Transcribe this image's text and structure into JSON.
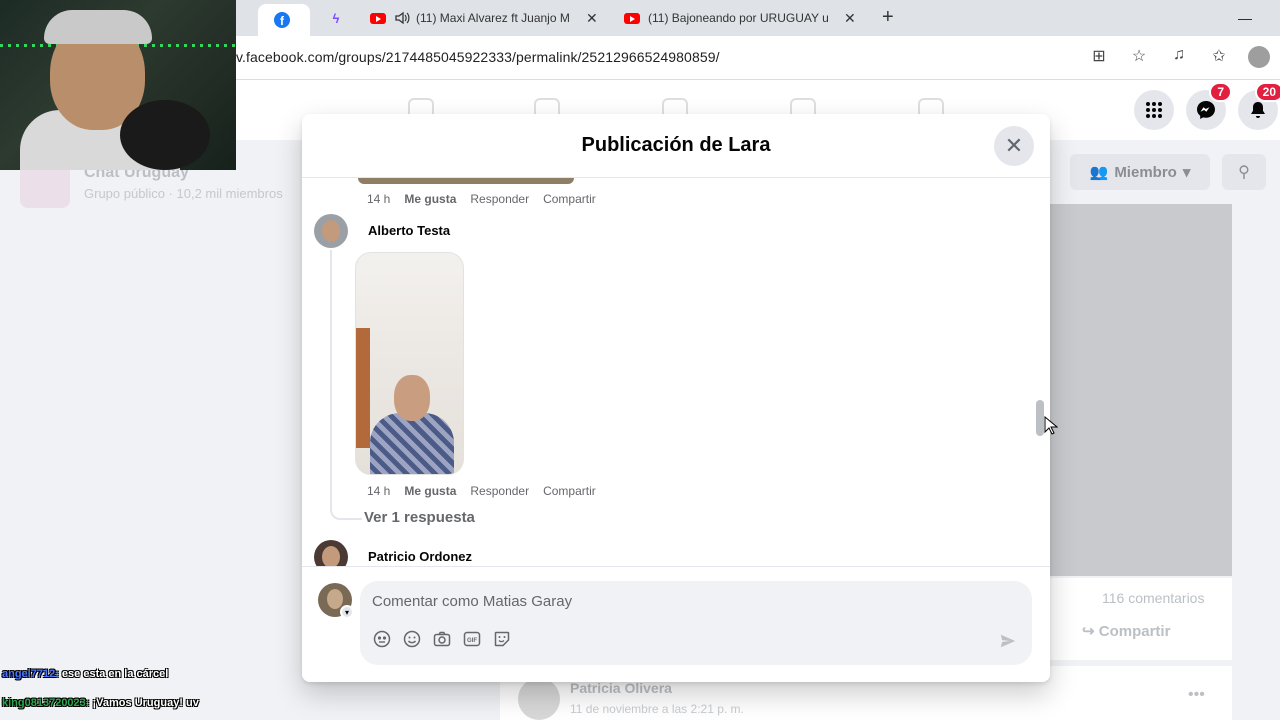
{
  "browser": {
    "tabs": [
      {
        "title": "",
        "icon": "facebook-icon"
      },
      {
        "title": "",
        "icon": "messenger-icon"
      },
      {
        "title": "(11) Maxi Alvarez ft Juanjo M",
        "icon": "youtube-icon"
      },
      {
        "title": "(11) Bajoneando por URUGUAY u",
        "icon": "youtube-icon"
      }
    ],
    "url": "v.facebook.com/groups/2174485045922333/permalink/2521296652498085​9/"
  },
  "fb_nav": {
    "messenger_badge": "7",
    "notifications_badge": "20"
  },
  "background": {
    "group_name": "Chat Uruguay",
    "group_sub": "Grupo público · 10,2 mil miembros",
    "member_button": "Miembro",
    "comments_count": "116 comentarios",
    "share_label": "Compartir",
    "next_post_author": "Patricia Olivera",
    "next_post_date": "11 de noviembre a las 2:21 p. m."
  },
  "modal": {
    "title": "Publicación de Lara",
    "comments": [
      {
        "time": "14 h",
        "like": "Me gusta",
        "reply": "Responder",
        "share": "Compartir"
      },
      {
        "author": "Alberto Testa",
        "time": "14 h",
        "like": "Me gusta",
        "reply": "Responder",
        "share": "Compartir",
        "see_replies": "Ver 1 respuesta"
      },
      {
        "author": "Patricio Ordonez"
      }
    ],
    "composer": {
      "placeholder": "Comentar como Matias Garay"
    }
  },
  "stream_chat": [
    {
      "user": "angel7712:",
      "message": " ese esta en la cárcel"
    },
    {
      "user": "king0813720023:",
      "message": " ¡Vamos Uruguay! uv"
    }
  ]
}
